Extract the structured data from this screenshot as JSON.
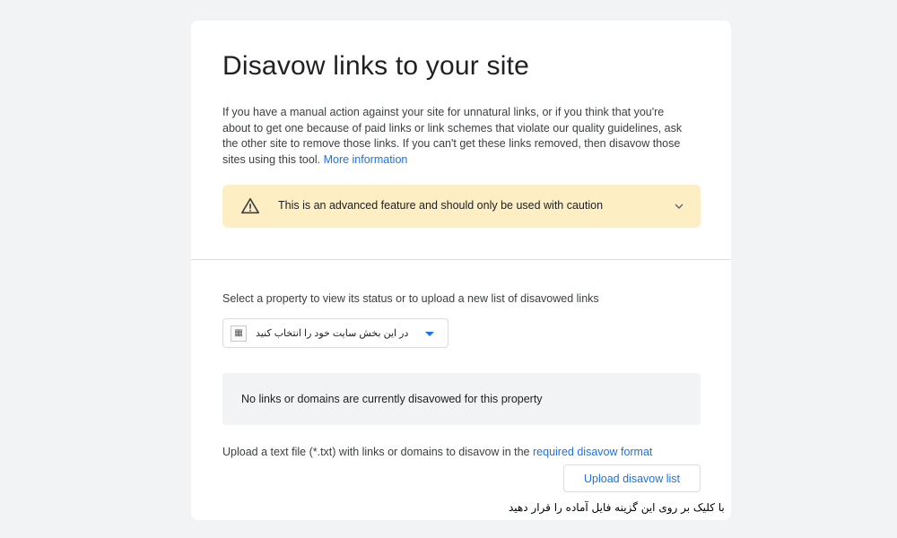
{
  "page": {
    "title": "Disavow links to your site",
    "intro_text": "If you have a manual action against your site for unnatural links, or if you think that you're about to get one because of paid links or link schemes that violate our quality guidelines, ask the other site to remove those links. If you can't get these links removed, then disavow those sites using this tool.",
    "intro_link": "More information"
  },
  "warning": {
    "text": "This is an advanced feature and should only be used with caution",
    "icon": "warning-triangle-icon",
    "toggle_icon": "chevron-down-icon",
    "background": "#fdefc3"
  },
  "property": {
    "label": "Select a property to view its status or to upload a new list of disavowed links",
    "selected_value": "در این بخش سایت خود را انتخاب کنید",
    "dropdown_icon": "caret-down-icon"
  },
  "status": {
    "message": "No links or domains are currently disavowed for this property"
  },
  "upload": {
    "text": "Upload a text file (*.txt) with links or domains to disavow in the",
    "link": "required disavow format",
    "button_label": "Upload disavow list"
  },
  "annotation": {
    "text": "با کلیک بر روی این گزینه فایل آماده را قرار دهید"
  },
  "colors": {
    "accent": "#1a73e8",
    "page_background": "#f1f3f4",
    "card_background": "#ffffff"
  }
}
